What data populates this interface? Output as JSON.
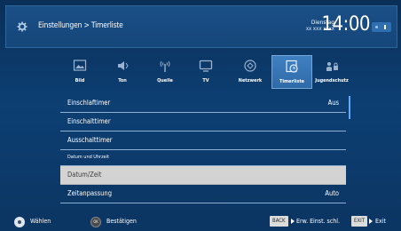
{
  "header": {
    "title": "Einstellungen > Timerliste",
    "date_day": "Dienstag",
    "date_value": "xx xxx xxxx",
    "clock": "14:00",
    "gear_icon": "gear-icon"
  },
  "categories": [
    {
      "label": "Bild",
      "icon": "image-icon"
    },
    {
      "label": "Ton",
      "icon": "speaker-icon"
    },
    {
      "label": "Quelle",
      "icon": "antenna-icon"
    },
    {
      "label": "TV",
      "icon": "tv-icon"
    },
    {
      "label": "Netzwerk",
      "icon": "network-globe-icon"
    },
    {
      "label": "Timerliste",
      "icon": "timer-list-icon",
      "active": true
    },
    {
      "label": "Jugendschutz",
      "icon": "parental-lock-icon"
    }
  ],
  "list": [
    {
      "label": "Einschlaftimer",
      "value": "Aus"
    },
    {
      "label": "Einschalttimer",
      "value": ""
    },
    {
      "label": "Ausschalttimer",
      "value": ""
    },
    {
      "label": "Datum und Uhrzeit",
      "section": true
    },
    {
      "label": "Datum/Zeit",
      "value": "",
      "selected": true
    },
    {
      "label": "Zeitanpassung",
      "value": "Auto"
    }
  ],
  "footer": {
    "select_label": "Wählen",
    "confirm_label": "Bestätigen",
    "ok_key": "OK",
    "back_key": "BACK",
    "back_label": "Erw. Einst. schl.",
    "exit_key": "EXIT",
    "exit_label": "Exit"
  },
  "colors": {
    "background": "#0c3a6b",
    "selected_row": "#d3d3d3",
    "active_tab": "#3f80c2",
    "scroll_indicator": "#62a8ff"
  }
}
